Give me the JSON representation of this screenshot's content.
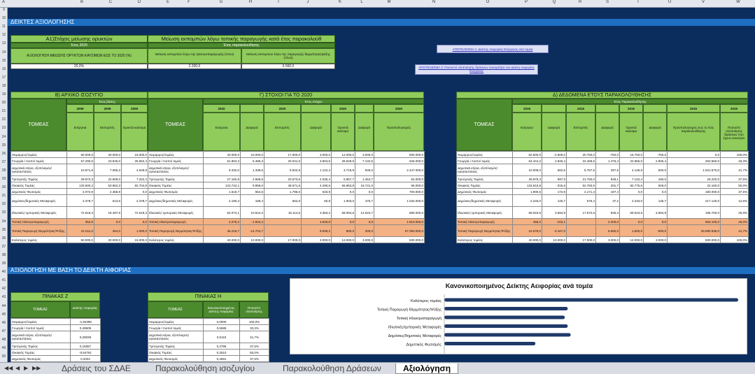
{
  "columns": [
    "A",
    "B",
    "C",
    "D",
    "E",
    "F",
    "G",
    "H",
    "I",
    "J",
    "K",
    "L",
    "M",
    "N",
    "O",
    "P",
    "Q",
    "R",
    "S",
    "T",
    "U",
    "V",
    "W"
  ],
  "rows": [
    "9",
    "10",
    "11",
    "12",
    "13",
    "14",
    "15",
    "16",
    "17",
    "18",
    "19",
    "20",
    "21",
    "22",
    "23",
    "24",
    "25",
    "26",
    "27",
    "28",
    "29",
    "30",
    "31",
    "32",
    "33",
    "34",
    "35",
    "36",
    "37",
    "38",
    "39",
    "40",
    "41",
    "42",
    "43",
    "44",
    "45",
    "46",
    "47",
    "48",
    "49",
    "50"
  ],
  "band1": "ΔΕΙΚΤΕΣ ΑΞΙΟΛΟΓΗΣΗΣ",
  "band2": "ΑΞΙΟΛΟΓΗΣΗ ΜΕ ΒΑΣΗ ΤΟ ΔΕΙΚΤΗ ΑΙΦΟΡΙΑΣ",
  "a1": {
    "title": "Α1)Στόχος μείωσης ορυκτών",
    "year": "Έτος 2020",
    "label": "ΑΞΙΟΛΟΓΗΣΗ ΜΕΙΩΣΗΣ ΟΡΥΚΤΩΝ ΚΑΥΣΙΜΩΝ ΕΩΣ ΤΟ 2020 (%)",
    "value": "20,0%"
  },
  "a2": {
    "title": "Μείωση εκπομπών λόγω τοπικής παραγωγής κατά έτος παρακολούθ",
    "year": "Έτος παρακολούθησης",
    "c1": "Μείωση εκπομπών λόγω της ηλεκτροπαραγωγής (τόνοι)",
    "c2": "Μείωση εκπομπών λόγω της παραγωγής θερμότητας/ψύξης (τόνοι)",
    "v1": "2.200,0",
    "v2": "6.560,0"
  },
  "links": {
    "r1": "ΑΠΟΤΕΛΕΣΜΑ 1: Δείκτης Αειφορίας Ενέργειας ανά τομέα",
    "r2": "ΑΠΟΤΕΛΕΣΜΑ 2: Ποσοστό υλοποίησης δράσεων συναρτήσει του Δείκτη Αειφορίας Ενέργειας"
  },
  "secB": {
    "title": "Β) ΑΡΧΙΚΟ ΙΣΟΖΥΓΙΟ",
    "sub": "Έτος βάσης",
    "years": [
      "2009",
      "2009",
      "2009"
    ],
    "cols": [
      "Ενέργεια",
      "Εκπομπές",
      "Ορυκτά καύσιμα"
    ]
  },
  "secG": {
    "title": "Γ) ΣΤΟΧΟΙ ΓΙΑ ΤΟ 2020",
    "sub": "Έτος στόχου",
    "years": [
      "2020",
      "2020",
      "2020",
      "2020",
      "2020"
    ],
    "cols": [
      "Ενέργεια",
      "Διαφορά",
      "Εκπομπές",
      "Διαφορά",
      "Ορυκτά καύσιμα",
      "Διαφορά",
      "Προϋπολογισμός"
    ]
  },
  "secD": {
    "title": "Δ) ΔΕΔΟΜΕΝΑ ΕΤΟΥΣ ΠΑΡΑΚΟΛΟΥΘΗΣΗΣ",
    "sub": "Έτος Παρακολούθησης",
    "years": [
      "2015",
      "2015",
      "2015",
      "2015",
      "2015"
    ],
    "cols": [
      "Ενέργεια",
      "Διαφορά",
      "Εκπομπές",
      "Διαφορά",
      "Ορυκτά καύσιμα",
      "Διαφορά",
      "Προϋπολογισμός έως το έτος παρακολούθησης",
      "Ποσοστό υλοποίησης δράσεων που έχουν εκκινήσει"
    ]
  },
  "tomeas": "ΤΟΜΕΑΣ",
  "sectors": [
    "Χειμαρρος/τομέας",
    "Γεωργία / Λοιποί τομείς",
    "Δημοτικά κτίρια, εξοπλισμός/εγκαταστάσεις",
    "Τριτογενής Τομέας",
    "Οικιακός Τομέας",
    "Δημοτικός Φωτισμός",
    "Δημόσιες/δημοτικές Μεταφορές",
    "Ιδιωτικές/ εμπορικές Μεταφορές",
    "Τοπική Ηλεκτροπαραγωγή",
    "Τοπική Παραγωγή Θερμότητας/Ψύξης",
    "Καλύτερος τομέας"
  ],
  "b_rows": [
    [
      "50.000,0",
      "20.000,0",
      "15.000,0"
    ],
    [
      "57.290,6",
      "23.946,0",
      "25.662,4"
    ],
    [
      "10.671,6",
      "7.065,2",
      "4.649,8"
    ],
    [
      "29.872,3",
      "22.609,0",
      "7.322,4"
    ],
    [
      "133.600,2",
      "53.962,3",
      "82.704,9"
    ],
    [
      "2.072,9",
      "2.358,9",
      "0,0"
    ],
    [
      "2.378,7",
      "613,6",
      "2.378,7"
    ],
    [
      "72.618,3",
      "18.497,8",
      "72.618,3"
    ],
    [
      "352,9",
      "0,0",
      "0,0"
    ],
    [
      "21.511,0",
      "364,0",
      "1.000,0"
    ],
    [
      "50.000,0",
      "20.000,0",
      "15.000,0"
    ]
  ],
  "g_rows": [
    [
      "40.000,0",
      "10.000,0",
      "17.000,0",
      "3.000,0",
      "12.000,0",
      "3.000,0",
      "500.000,0"
    ],
    [
      "51.804,3",
      "5.486,3",
      "20.041,5",
      "3.904,5",
      "28.529,9",
      "7.132,5",
      "626.000,0"
    ],
    [
      "9.332,0",
      "1.339,6",
      "5.942,8",
      "1.122,4",
      "3.719,8",
      "930,0",
      "2.447.000,0"
    ],
    [
      "27.182,8",
      "2.689,5",
      "20.573,6",
      "2.035,4",
      "5.857,7",
      "1.464,7",
      "52.000,0"
    ],
    [
      "123.742,1",
      "9.858,0",
      "48.671,6",
      "4.290,6",
      "66.963,8",
      "16.741,0",
      "96.000,0"
    ],
    [
      "1.519,7",
      "554,6",
      "1.795,0",
      "533,9",
      "0,0",
      "0,0",
      "700.000,0"
    ],
    [
      "2.190,3",
      "188,4",
      "562,8",
      "50,8",
      "1.903,0",
      "475,7",
      "1.034.000,0"
    ],
    [
      "62.074,1",
      "10.544,2",
      "15.114,6",
      "3.383,2",
      "58.094,6",
      "14.523,7",
      "880.000,0"
    ],
    [
      "2.276,2",
      "-1.923,4",
      "",
      "4.840,8",
      "0,0",
      "0,0",
      "1.810.000,0"
    ],
    [
      "46.215,7",
      "-14.704,7",
      "",
      "9.936,2",
      "800,0",
      "200,0",
      "57.050.000,0"
    ],
    [
      "40.000,0",
      "10.000,0",
      "17.000,0",
      "3.000,0",
      "12.000,0",
      "3.000,0",
      "500.000,0"
    ]
  ],
  "d_rows": [
    [
      "52.500,0",
      "-2.500,0",
      "20.750,0",
      "-750,0",
      "15.750,0",
      "-750,0",
      "0,0",
      "100,0%"
    ],
    [
      "54.444,2",
      "2.846,4",
      "22.469,6",
      "1.476,4",
      "22.856,0",
      "2.806,4",
      "263.560,0",
      "33,3%"
    ],
    [
      "10.009,0",
      "662,6",
      "6.767,5",
      "297,6",
      "4.149,8",
      "500,0",
      "1.521.570,0",
      "41,7%"
    ],
    [
      "28.875,3",
      "997,0",
      "21.760,0",
      "849,1",
      "7.142,4",
      "180,0",
      "25.220,0",
      "37,5%"
    ],
    [
      "133.915,8",
      "-315,6",
      "52.760,5",
      "201,7",
      "82.775,6",
      "929,0",
      "22.160,0",
      "50,0%"
    ],
    [
      "1.900,5",
      "172,9",
      "2.171,4",
      "187,4",
      "0,0",
      "0,0",
      "180.000,0",
      "37,5%"
    ],
    [
      "2.233,0",
      "145,7",
      "576,4",
      "37,2",
      "2.233,0",
      "145,7",
      "217.140,0",
      "12,5%"
    ],
    [
      "69.023,5",
      "3.594,9",
      "17.572,6",
      "925,3",
      "69.023,5",
      "3.594,9",
      "185.700,0",
      "25,0%"
    ],
    [
      "456,0",
      "-103,1",
      "",
      "2.200,0",
      "0,0",
      "0,0",
      "553.100,0",
      "25,0%"
    ],
    [
      "24.678,0",
      "-3.167,0",
      "",
      "6.560,0",
      "1.500,0",
      "-500,0",
      "26.990.536,0",
      "41,7%"
    ],
    [
      "40.000,0",
      "10.000,0",
      "17.000,0",
      "3.000,0",
      "12.000,0",
      "3.000,0",
      "500.000,0",
      "100,0%"
    ]
  ],
  "tableZ": {
    "title": "ΠΙΝΑΚΑΣ Ζ",
    "h1": "ΤΟΜΕΑΣ",
    "h2": "Δείκτης Αειφορίας",
    "rows": [
      [
        "Χειμαρρος/τομέας",
        "-1,94396"
      ],
      [
        "Γεωργία / Λοιποί τομείς",
        "0,49509"
      ],
      [
        "Δημοτικά κτίρια, εξοπλισμός/εγκαταστάσεις",
        "0,29039"
      ],
      [
        "Τριτογενής Τομέας",
        "0,15087"
      ],
      [
        "Οικιακός Τομέας",
        "-0,64761"
      ],
      [
        "Δημοτικός Φωτισμός",
        "0,2022"
      ]
    ]
  },
  "tableH": {
    "title": "ΠΙΝΑΚΑΣ Η",
    "h1": "ΤΟΜΕΑΣ",
    "h2": "Κανονικοποιημένος Δείκτης Αειφορίας",
    "h3": "Ποσοστό υλοποίησης",
    "rows": [
      [
        "Χειμαρρος/τομέας",
        "0,0000",
        "100,0%"
      ],
      [
        "Γεωργία / Λοιποί τομείς",
        "0,5585",
        "33,3%"
      ],
      [
        "Δημοτικά κτίρια, εξοπλισμός/εγκαταστάσεις",
        "0,5115",
        "41,7%"
      ],
      [
        "Τριτογενής Τομέας",
        "0,4796",
        "37,5%"
      ],
      [
        "Οικιακός Τομέας",
        "0,2510",
        "50,0%"
      ],
      [
        "Δημοτικός Φωτισμός",
        "0,4591",
        "37,5%"
      ]
    ]
  },
  "chart_data": {
    "type": "bar",
    "orientation": "horizontal",
    "title": "Κανονικοποιημένος Δείκτης Αειφορίας ανά τομέα",
    "categories": [
      "Καλύτερος τομέας",
      "Τοπική Παραγωγή Θερμότητας/Ψύξης",
      "Τοπική Ηλεκτροπαραγωγή",
      "Ιδιωτικές/εμπορικές Μεταφορές",
      "Δημόσιες/δημοτικές Μεταφορές",
      "Δημοτικός Φωτισμός"
    ],
    "values": [
      1.0,
      0.42,
      0.41,
      0.42,
      0.43,
      0.31
    ],
    "xlim": [
      0,
      1.0
    ],
    "bar_color": "#1f3a68"
  },
  "sheet_tabs": {
    "nav": [
      "◀◀",
      "◀",
      "▶",
      "▶▶"
    ],
    "tabs": [
      "Δράσεις του ΣΔΑΕ",
      "Παρακολούθηση ισοζυγίου",
      "Παρακολούθηση Δράσεων",
      "Αξιολόγηση"
    ],
    "active": 3
  }
}
